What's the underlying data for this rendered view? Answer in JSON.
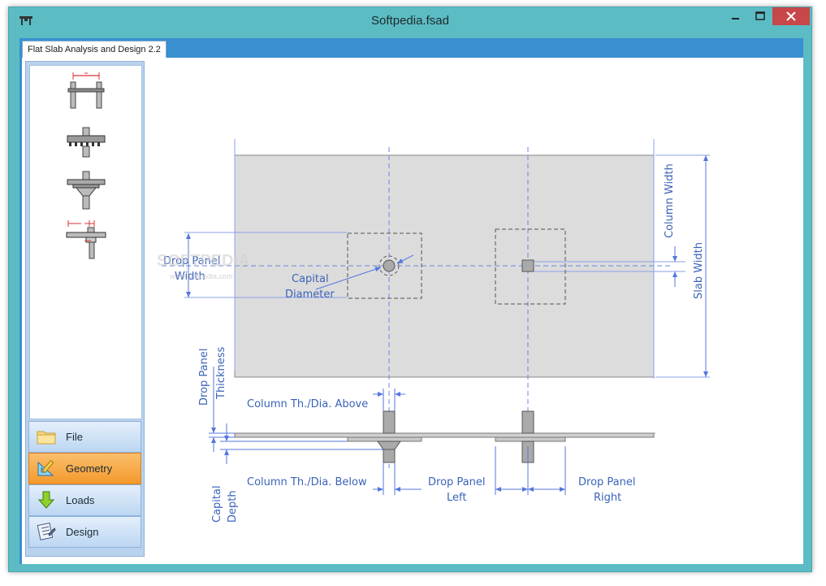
{
  "window": {
    "title": "Softpedia.fsad",
    "controls": {
      "minimize": "minimize",
      "maximize": "maximize",
      "close": "close"
    }
  },
  "tab": {
    "label": "Flat Slab Analysis and Design 2.2"
  },
  "toolbox": {
    "tools": [
      "span-length-tool",
      "slab-section-tool",
      "column-capital-tool",
      "drop-panel-tool"
    ]
  },
  "nav": {
    "file": "File",
    "geometry": "Geometry",
    "loads": "Loads",
    "design": "Design",
    "active": "Geometry"
  },
  "diagram": {
    "labels": {
      "drop_panel_width_1": "Drop Panel",
      "drop_panel_width_2": "Width",
      "capital_diameter_1": "Capital",
      "capital_diameter_2": "Diameter",
      "column_width": "Column Width",
      "slab_width": "Slab Width",
      "drop_panel_thickness_1": "Drop Panel",
      "drop_panel_thickness_2": "Thickness",
      "column_above": "Column Th./Dia. Above",
      "column_below": "Column Th./Dia. Below",
      "drop_panel_left_1": "Drop Panel",
      "drop_panel_left_2": "Left",
      "drop_panel_right_1": "Drop Panel",
      "drop_panel_right_2": "Right",
      "capital_depth_1": "Capital",
      "capital_depth_2": "Depth"
    },
    "colors": {
      "dimension": "#5577dd",
      "slab": "#dcdcdc",
      "member": "#a8a8a8"
    }
  },
  "watermark": {
    "text": "SOFTPEDIA",
    "url": "www.softpedia.com"
  }
}
